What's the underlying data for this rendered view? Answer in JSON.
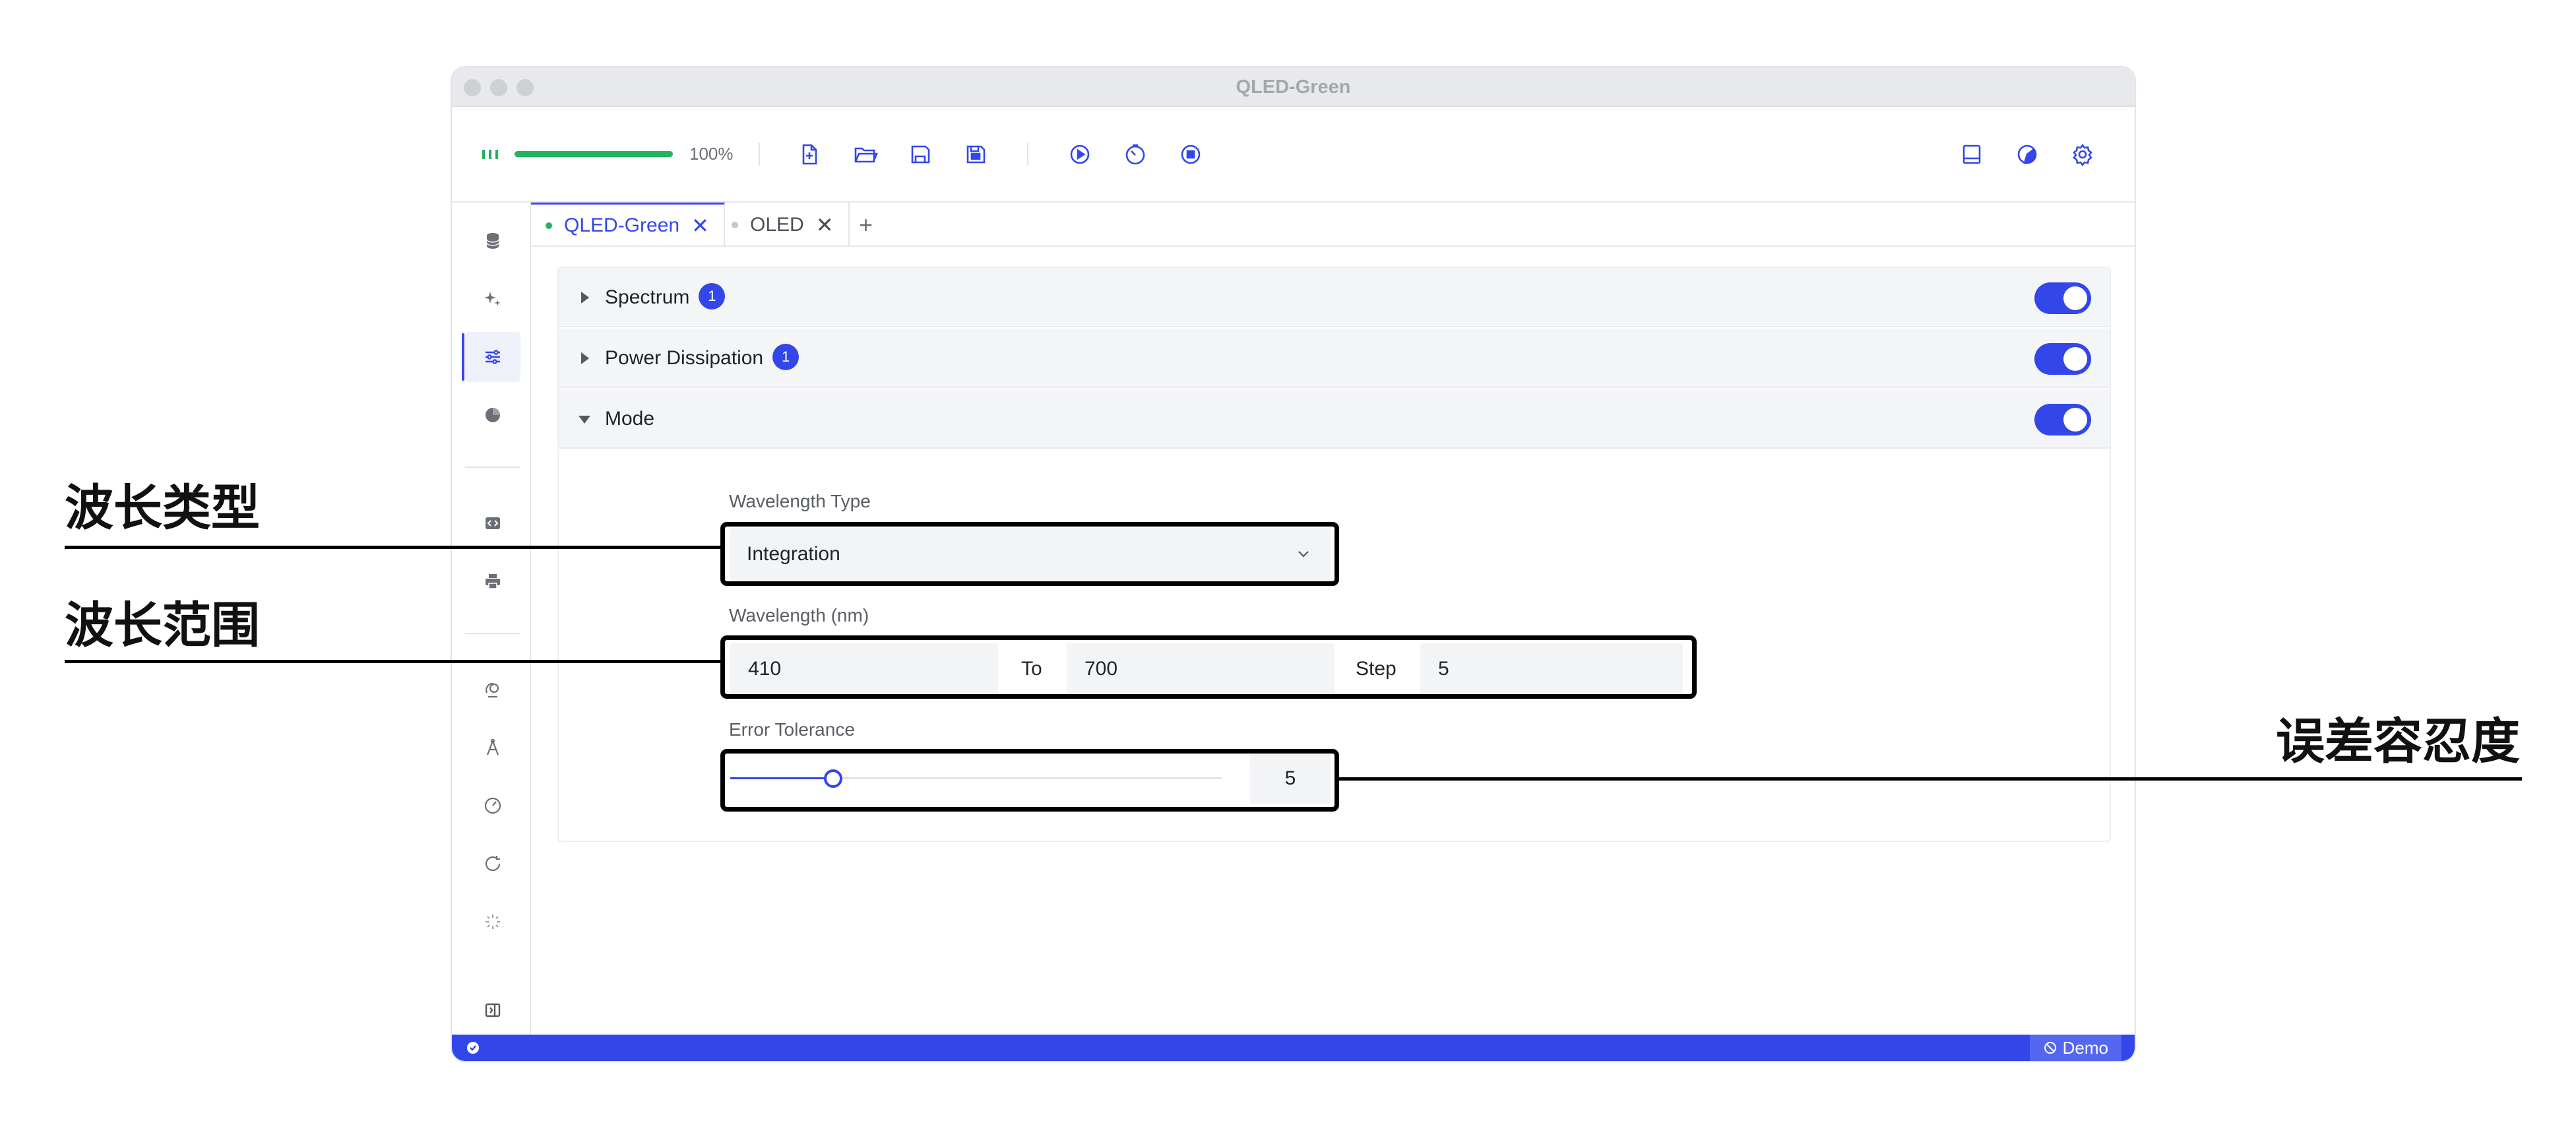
{
  "window": {
    "title": "QLED-Green"
  },
  "toolbar": {
    "progress": 100,
    "progress_label": "100%"
  },
  "tabs": [
    {
      "label": "QLED-Green",
      "close": "✕",
      "status_color": "#21b45c"
    },
    {
      "label": "OLED",
      "close": "✕",
      "status_color": "#c5c7cc"
    }
  ],
  "tab_add": "+",
  "sections": [
    {
      "label": "Spectrum",
      "badge": "1",
      "expanded": false,
      "enabled": true
    },
    {
      "label": "Power Dissipation",
      "badge": "1",
      "expanded": false,
      "enabled": true
    },
    {
      "label": "Mode",
      "badge": "",
      "expanded": true,
      "enabled": true
    }
  ],
  "mode": {
    "wavelength_type_label": "Wavelength Type",
    "wavelength_type_value": "Integration",
    "wavelength_label": "Wavelength (nm)",
    "wavelength_from": "410",
    "to_label": "To",
    "wavelength_to": "700",
    "step_label": "Step",
    "step_value": "5",
    "error_tolerance_label": "Error Tolerance",
    "error_tolerance_value": "5",
    "error_tolerance_fraction": 0.21
  },
  "statusbar": {
    "demo_label": "Demo"
  },
  "annotations": {
    "wavelength_type": "波长类型",
    "wavelength_range": "波长范围",
    "error_tolerance": "误差容忍度"
  },
  "colors": {
    "accent": "#3346ea",
    "success": "#21b45c"
  }
}
